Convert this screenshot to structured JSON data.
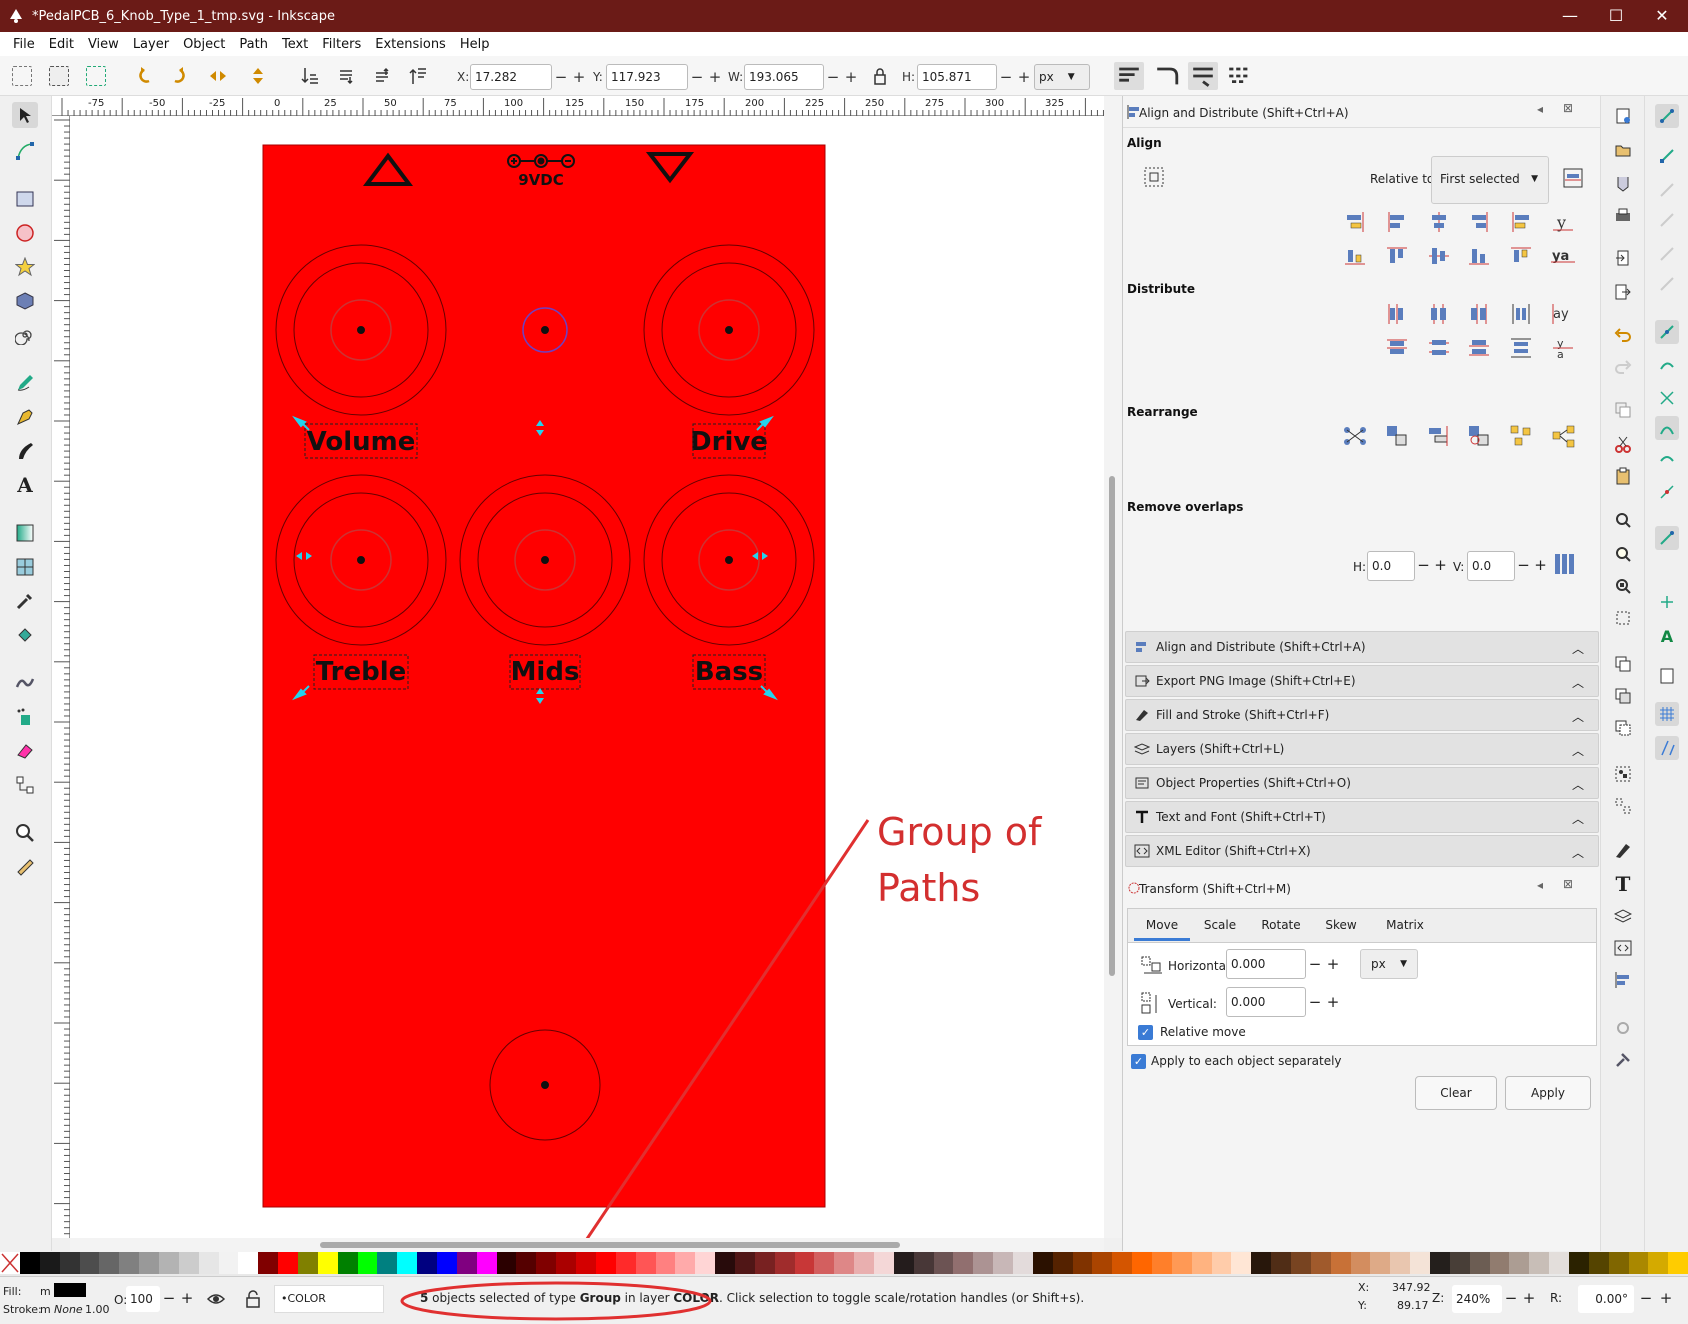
{
  "window": {
    "title": "*PedalPCB_6_Knob_Type_1_tmp.svg - Inkscape",
    "minimize": "—",
    "maximize": "☐",
    "close": "✕"
  },
  "menu": [
    "File",
    "Edit",
    "View",
    "Layer",
    "Object",
    "Path",
    "Text",
    "Filters",
    "Extensions",
    "Help"
  ],
  "toolbar": {
    "x_label": "X:",
    "x_value": "17.282",
    "y_label": "Y:",
    "y_value": "117.923",
    "w_label": "W:",
    "w_value": "193.065",
    "h_label": "H:",
    "h_value": "105.871",
    "unit": "px"
  },
  "ruler": {
    "h_ticks": [
      "-75",
      "-50",
      "-25",
      "0",
      "25",
      "50",
      "75",
      "100",
      "125",
      "150",
      "175",
      "200",
      "225",
      "250",
      "275",
      "300",
      "325"
    ]
  },
  "canvas": {
    "labels": [
      "Volume",
      "Drive",
      "Treble",
      "Mids",
      "Bass"
    ],
    "power_label": "9VDC",
    "annotation_line1": "Group of",
    "annotation_line2": "Paths",
    "panel_color": "#ff0000"
  },
  "align_panel": {
    "title": "Align and Distribute (Shift+Ctrl+A)",
    "align_label": "Align",
    "relative_to_label": "Relative to:",
    "relative_to_value": "First selected",
    "distribute_label": "Distribute",
    "rearrange_label": "Rearrange",
    "remove_overlaps_label": "Remove overlaps",
    "h_label": "H:",
    "h_value": "0.0",
    "v_label": "V:",
    "v_value": "0.0"
  },
  "docked_dialogs": [
    "Align and Distribute (Shift+Ctrl+A)",
    "Export PNG Image (Shift+Ctrl+E)",
    "Fill and Stroke (Shift+Ctrl+F)",
    "Layers (Shift+Ctrl+L)",
    "Object Properties (Shift+Ctrl+O)",
    "Text and Font (Shift+Ctrl+T)",
    "XML Editor (Shift+Ctrl+X)"
  ],
  "transform": {
    "title": "Transform (Shift+Ctrl+M)",
    "tabs": [
      "Move",
      "Scale",
      "Rotate",
      "Skew",
      "Matrix"
    ],
    "horizontal_label": "Horizontal:",
    "horizontal_value": "0.000",
    "vertical_label": "Vertical:",
    "vertical_value": "0.000",
    "unit": "px",
    "relative_move_label": "Relative move",
    "apply_each_label": "Apply to each object separately",
    "clear_label": "Clear",
    "apply_label": "Apply"
  },
  "status": {
    "fill_label": "Fill:",
    "fill_value": "m",
    "stroke_label": "Stroke:",
    "stroke_value": "m",
    "stroke_none": "None",
    "stroke_width": "1.00",
    "opacity_label": "O:",
    "opacity_value": "100",
    "layer": "•COLOR",
    "msg_count": "5",
    "msg_part1": " objects selected of type ",
    "msg_type": "Group",
    "msg_part2": " in layer ",
    "msg_layer": "COLOR",
    "msg_part3": ". Click selection to toggle scale/rotation handles (or Shift+s).",
    "x_label": "X:",
    "x_value": "347.92",
    "y_label": "Y:",
    "y_value": "89.17",
    "z_label": "Z:",
    "zoom": "240%",
    "r_label": "R:",
    "rotation": "0.00°"
  }
}
